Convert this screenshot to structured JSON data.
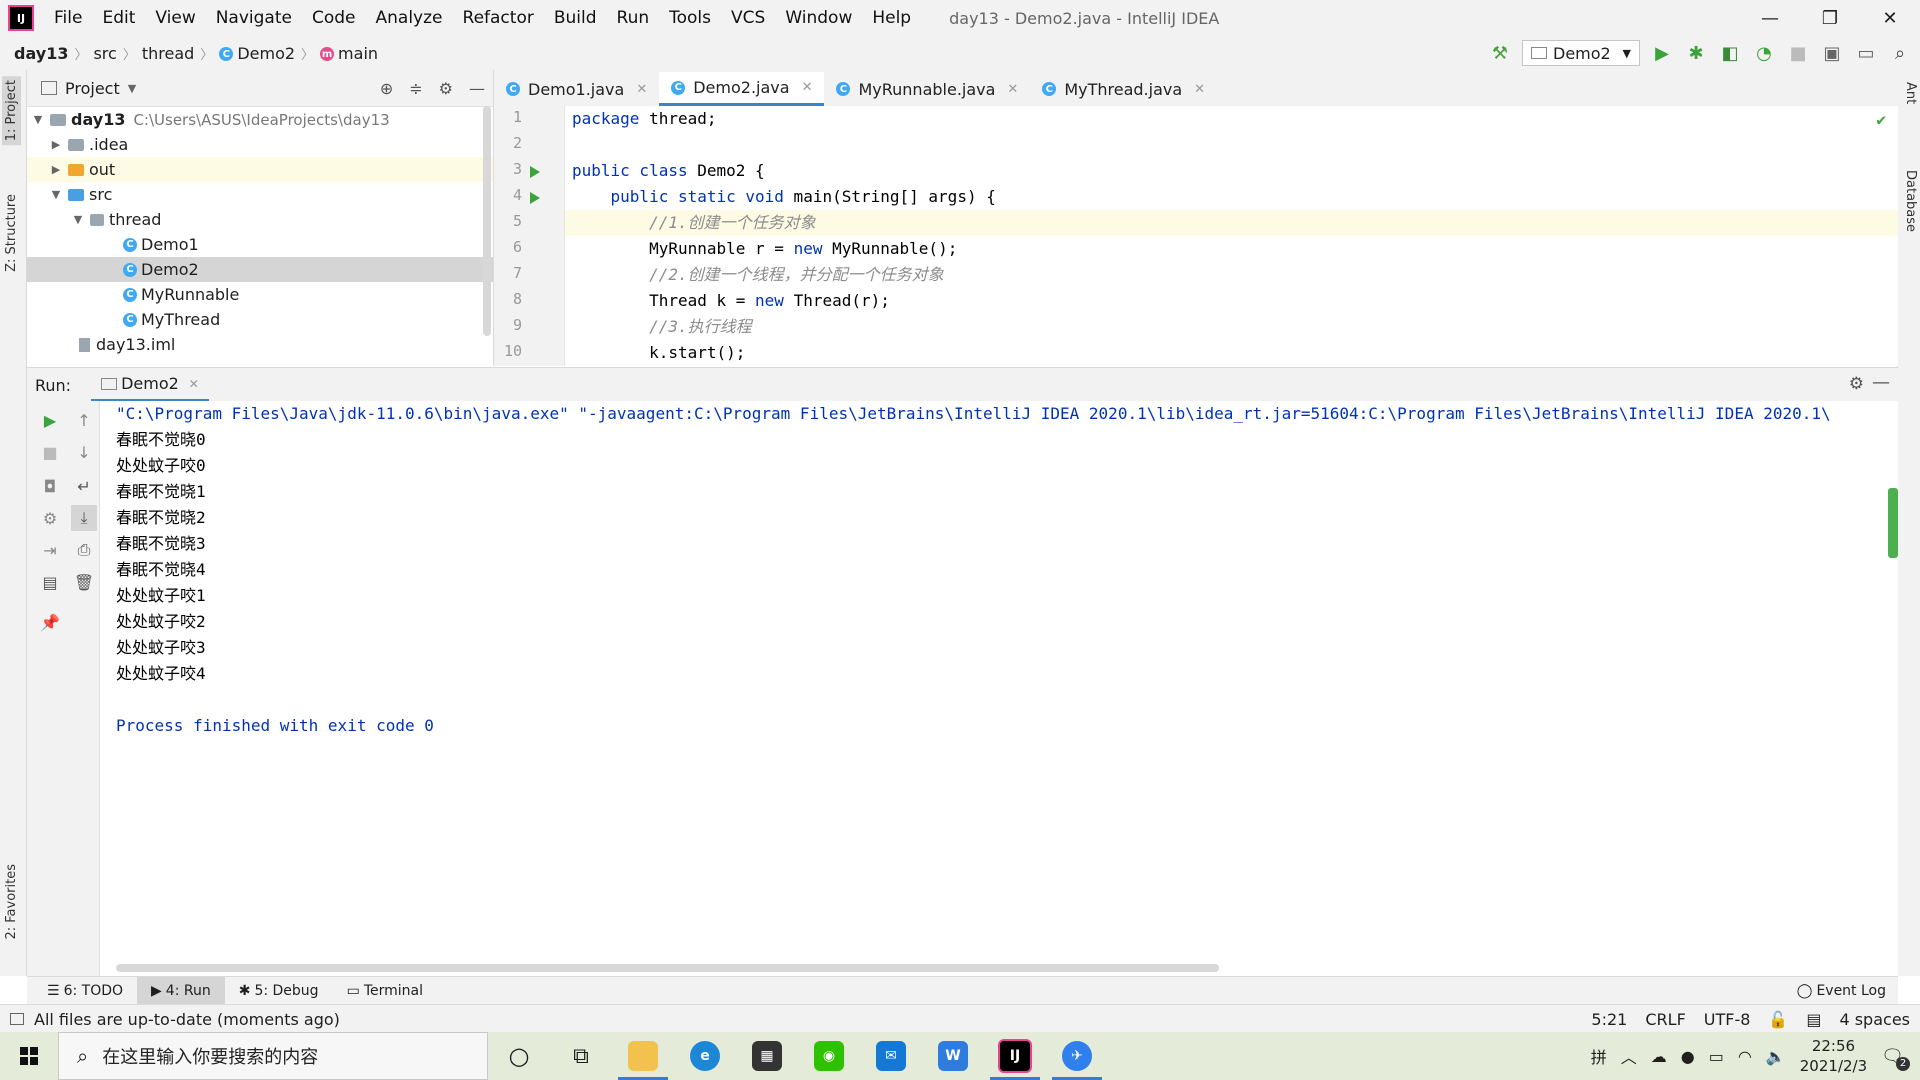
{
  "menubar": {
    "items": [
      "File",
      "Edit",
      "View",
      "Navigate",
      "Code",
      "Analyze",
      "Refactor",
      "Build",
      "Run",
      "Tools",
      "VCS",
      "Window",
      "Help"
    ],
    "title": "day13 - Demo2.java - IntelliJ IDEA"
  },
  "navbar": {
    "crumbs": [
      "day13",
      "src",
      "thread",
      "Demo2",
      "main"
    ],
    "run_config": "Demo2"
  },
  "left_strip": {
    "project": "1: Project",
    "structure": "Z: Structure",
    "favorites": "2: Favorites"
  },
  "right_strip": {
    "ant": "Ant",
    "database": "Database"
  },
  "project": {
    "header": "Project",
    "tree": [
      {
        "label": "day13",
        "hint": "C:\\Users\\ASUS\\IdeaProjects\\day13"
      },
      {
        "label": ".idea"
      },
      {
        "label": "out"
      },
      {
        "label": "src"
      },
      {
        "label": "thread"
      },
      {
        "label": "Demo1"
      },
      {
        "label": "Demo2"
      },
      {
        "label": "MyRunnable"
      },
      {
        "label": "MyThread"
      },
      {
        "label": "day13.iml"
      }
    ]
  },
  "editor": {
    "tabs": [
      "Demo1.java",
      "Demo2.java",
      "MyRunnable.java",
      "MyThread.java"
    ],
    "line_numbers": [
      "1",
      "2",
      "3",
      "4",
      "5",
      "6",
      "7",
      "8",
      "9",
      "10"
    ],
    "lines": {
      "l1a": "package",
      "l1b": " thread;",
      "l3a": "public class",
      "l3b": " Demo2 {",
      "l4a": "    public static void",
      "l4b": " main(String[] args) {",
      "l5": "        //1.创建一个任务对象",
      "l6a": "        MyRunnable r = ",
      "l6b": "new",
      "l6c": " MyRunnable();",
      "l7": "        //2.创建一个线程，并分配一个任务对象",
      "l8a": "        Thread k = ",
      "l8b": "new",
      "l8c": " Thread(r);",
      "l9": "        //3.执行线程",
      "l10": "        k.start();"
    }
  },
  "run": {
    "label": "Run:",
    "tab": "Demo2",
    "command": "\"C:\\Program Files\\Java\\jdk-11.0.6\\bin\\java.exe\" \"-javaagent:C:\\Program Files\\JetBrains\\IntelliJ IDEA 2020.1\\lib\\idea_rt.jar=51604:C:\\Program Files\\JetBrains\\IntelliJ IDEA 2020.1\\",
    "output": [
      "春眠不觉晓0",
      "处处蚊子咬0",
      "春眠不觉晓1",
      "春眠不觉晓2",
      "春眠不觉晓3",
      "春眠不觉晓4",
      "处处蚊子咬1",
      "处处蚊子咬2",
      "处处蚊子咬3",
      "处处蚊子咬4"
    ],
    "finished": "Process finished with exit code 0"
  },
  "bottom_tabs": {
    "todo": "6: TODO",
    "run": "4: Run",
    "debug": "5: Debug",
    "terminal": "Terminal",
    "event_log": "Event Log"
  },
  "status": {
    "message": "All files are up-to-date (moments ago)",
    "position": "5:21",
    "line_sep": "CRLF",
    "encoding": "UTF-8",
    "indent": "4 spaces"
  },
  "taskbar": {
    "search_placeholder": "在这里输入你要搜索的内容",
    "ime": "拼",
    "time": "22:56",
    "date": "2021/2/3",
    "notif_count": "2"
  }
}
